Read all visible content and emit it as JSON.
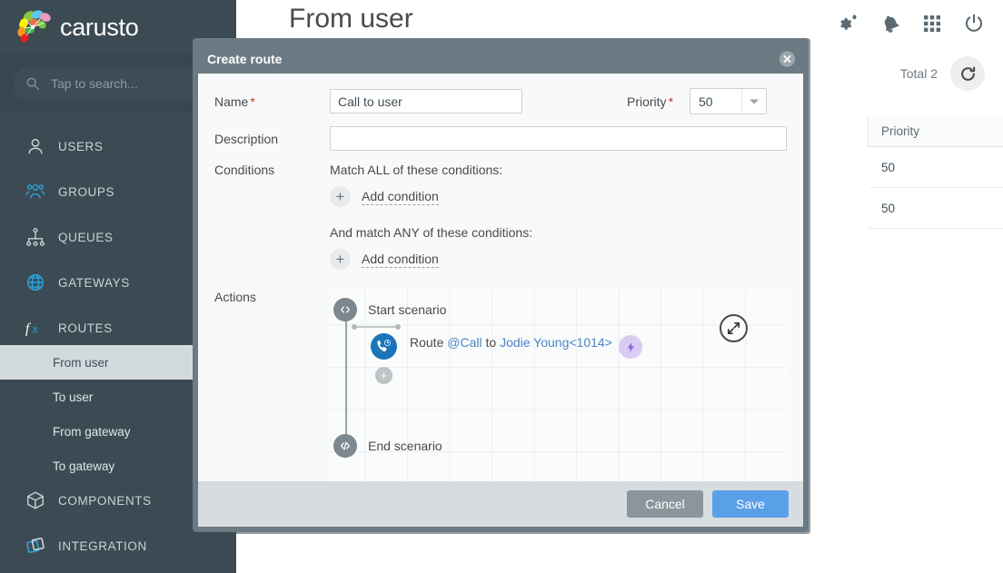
{
  "brand": {
    "name": "carusto",
    "logo_icon": "carusto-logo-icon"
  },
  "search": {
    "placeholder": "Tap to search...",
    "icon": "search-icon"
  },
  "sidebar": {
    "items": [
      {
        "label": "USERS",
        "icon": "user-icon",
        "type": "group"
      },
      {
        "label": "GROUPS",
        "icon": "group-icon",
        "type": "group"
      },
      {
        "label": "QUEUES",
        "icon": "queue-icon",
        "type": "group"
      },
      {
        "label": "GATEWAYS",
        "icon": "globe-icon",
        "type": "group"
      },
      {
        "label": "ROUTES",
        "icon": "fx-icon",
        "type": "group"
      },
      {
        "label": "From user",
        "type": "sub",
        "active": true
      },
      {
        "label": "To user",
        "type": "sub",
        "active": false
      },
      {
        "label": "From gateway",
        "type": "sub",
        "active": false
      },
      {
        "label": "To gateway",
        "type": "sub",
        "active": false
      },
      {
        "label": "COMPONENTS",
        "icon": "cube-icon",
        "type": "group"
      },
      {
        "label": "INTEGRATION",
        "icon": "layers-icon",
        "type": "group"
      }
    ]
  },
  "header": {
    "title": "From user",
    "icons": [
      {
        "name": "settings-gears-icon"
      },
      {
        "name": "bell-icon"
      },
      {
        "name": "apps-grid-icon"
      },
      {
        "name": "power-icon"
      }
    ]
  },
  "toolbar": {
    "total_label": "Total 2",
    "refresh_icon": "refresh-icon"
  },
  "table": {
    "columns": [
      "Priority"
    ],
    "rows": [
      {
        "priority": "50"
      },
      {
        "priority": "50"
      }
    ]
  },
  "modal": {
    "title": "Create route",
    "close_icon": "close-icon",
    "name": {
      "label": "Name",
      "required": "*",
      "value": "Call to user"
    },
    "priority": {
      "label": "Priority",
      "required": "*",
      "value": "50",
      "caret_icon": "chevron-down-icon"
    },
    "description": {
      "label": "Description",
      "value": "",
      "placeholder": ""
    },
    "conditions": {
      "label": "Conditions",
      "all_heading": "Match ALL of these conditions:",
      "all_add_label": "Add condition",
      "any_heading": "And match ANY of these conditions:",
      "any_add_label": "Add condition",
      "add_icon": "plus-icon"
    },
    "actions": {
      "label": "Actions",
      "start_node": {
        "text": "Start scenario",
        "icon": "code-brackets-icon"
      },
      "end_node": {
        "text": "End scenario",
        "icon": "code-brackets-icon"
      },
      "step": {
        "icon": "phone-clock-icon",
        "text_prefix": "Route ",
        "text_channel": "@Call",
        "text_middle": " to ",
        "text_target": "Jodie Young<1014>",
        "badge_icon": "lightning-bolt-icon"
      },
      "add_step_icon": "plus-icon",
      "expand_icon": "expand-arrows-icon"
    },
    "footer": {
      "cancel_label": "Cancel",
      "save_label": "Save"
    }
  },
  "colors": {
    "sidebar_bg": "#3c4b53",
    "modal_border": "#6c7a83",
    "save_button": "#5aa0e8",
    "cancel_button": "#8b959b",
    "accent_blue": "#1b75bb",
    "badge_purple": "#d9ccf2",
    "required_red": "#c0392b"
  }
}
